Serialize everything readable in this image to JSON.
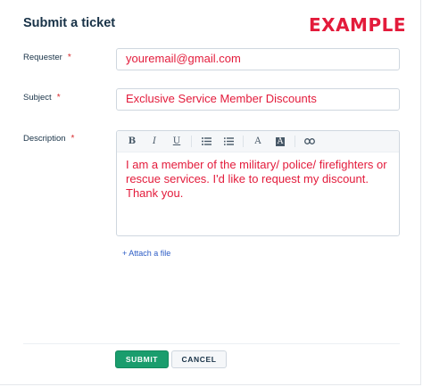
{
  "header": {
    "title": "Submit a ticket",
    "logo": "EXAMPLE"
  },
  "colors": {
    "accent": "#e31b3b",
    "primary_button": "#1a9d6d",
    "link": "#2c5cc5"
  },
  "form": {
    "requester": {
      "label": "Requester",
      "required_mark": "*",
      "value": "youremail@gmail.com"
    },
    "subject": {
      "label": "Subject",
      "required_mark": "*",
      "value": "Exclusive Service Member Discounts"
    },
    "description": {
      "label": "Description",
      "required_mark": "*",
      "value": "I am a member of the military/ police/ firefighters or rescue services. I'd like to request my discount. Thank you.",
      "toolbar": {
        "bold": "B",
        "italic": "I",
        "underline": "U",
        "font_color": "A",
        "bg_color": "A"
      }
    },
    "attach_label": "+ Attach a file"
  },
  "actions": {
    "submit_label": "SUBMIT",
    "cancel_label": "CANCEL"
  }
}
